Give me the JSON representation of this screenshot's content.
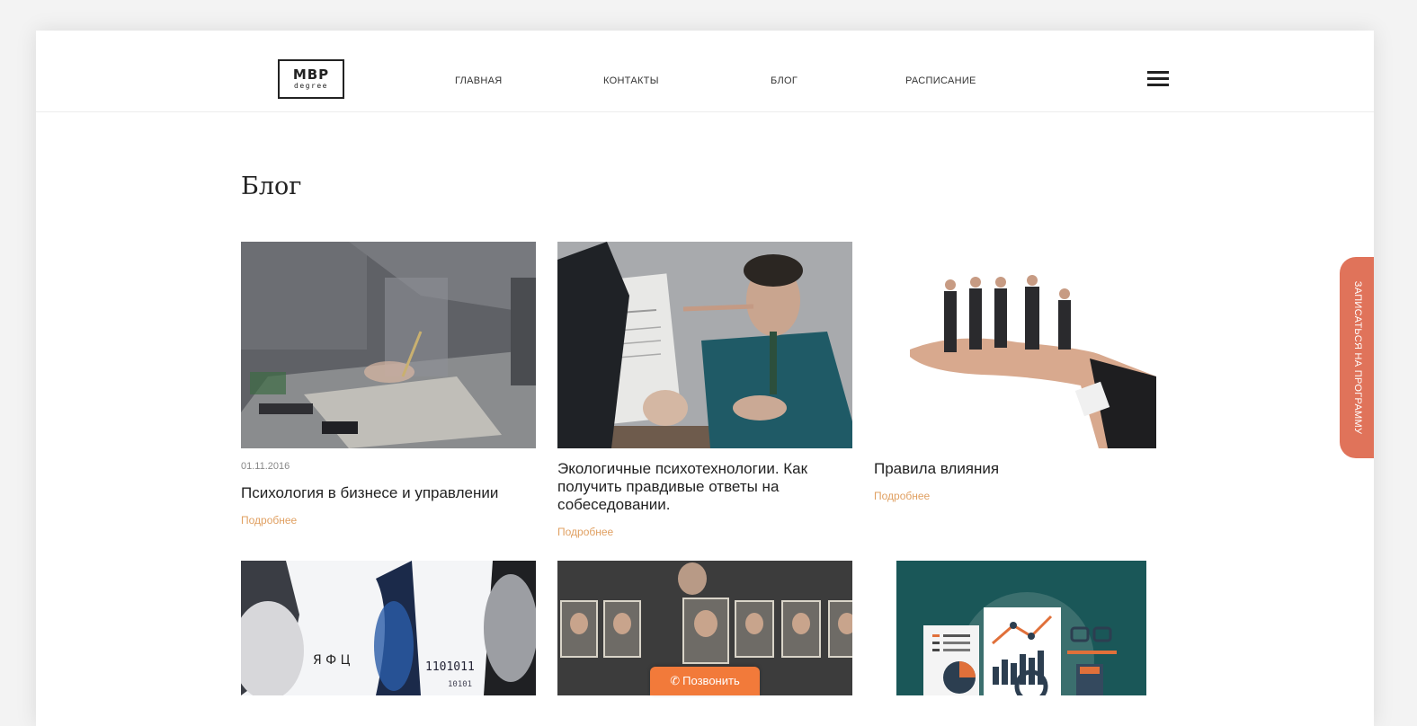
{
  "logo": {
    "main": "MBP",
    "sub": "degree"
  },
  "nav": {
    "items": [
      {
        "label": "ГЛАВНАЯ"
      },
      {
        "label": "КОНТАКТЫ"
      },
      {
        "label": "БЛОГ"
      },
      {
        "label": "РАСПИСАНИЕ"
      }
    ],
    "menu_icon": "hamburger-menu-icon"
  },
  "page": {
    "title": "Блог"
  },
  "posts": [
    {
      "date": "01.11.2016",
      "title": "Психология в бизнесе и управлении",
      "more": "Подробнее",
      "image": "desk-handshake-photo"
    },
    {
      "title": "Экологичные психотехнологии. Как получить правдивые ответы на собеседовании.",
      "more": "Подробнее",
      "image": "interview-pinocchio-photo"
    },
    {
      "title": "Правила влияния",
      "more": "Подробнее",
      "image": "businesspeople-on-hand-photo"
    },
    {
      "image": "communication-faces-photo"
    },
    {
      "image": "portraits-selection-photo"
    },
    {
      "image": "analytics-infographic-photo"
    }
  ],
  "side_tab": {
    "label": "ЗАПИСАТЬСЯ НА ПРОГРАММУ"
  },
  "call_button": {
    "label": "Позвонить",
    "icon": "phone-icon"
  },
  "colors": {
    "accent": "#e0a062",
    "side_tab": "#e0735a",
    "call_button": "#f27a3a"
  }
}
